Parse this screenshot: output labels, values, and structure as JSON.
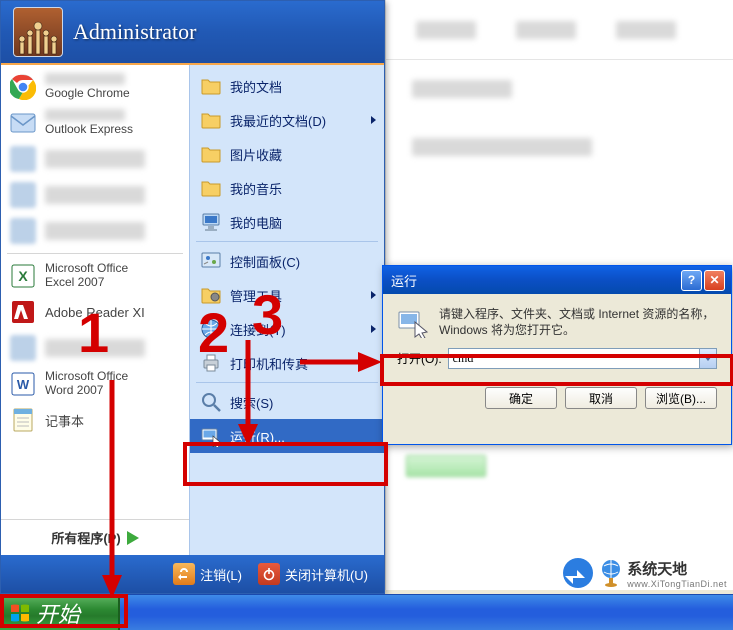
{
  "user_name": "Administrator",
  "left_items": [
    {
      "id": "chrome",
      "line1": "Google Chrome",
      "twoLine": true,
      "blurTop": true
    },
    {
      "id": "outlook",
      "line1": "Outlook Express",
      "twoLine": true,
      "blurTop": true
    },
    {
      "id": "blurred3",
      "line1": "",
      "blurAll": true
    },
    {
      "id": "blurred4",
      "line1": "",
      "blurAll": true
    },
    {
      "id": "blurred5",
      "line1": "",
      "blurAll": true
    },
    {
      "id": "excel",
      "line1": "Microsoft Office",
      "line2": "Excel 2007",
      "twoLine": true
    },
    {
      "id": "adobe",
      "line1": "Adobe Reader XI"
    },
    {
      "id": "blurred8",
      "line1": "",
      "blurAll": true
    },
    {
      "id": "word",
      "line1": "Microsoft Office",
      "line2": "Word 2007",
      "twoLine": true
    },
    {
      "id": "notepad",
      "line1": "记事本"
    }
  ],
  "all_programs_label": "所有程序(P)",
  "right_items": [
    {
      "id": "mydocs",
      "label": "我的文档",
      "icon": "folder"
    },
    {
      "id": "recent",
      "label": "我最近的文档(D)",
      "icon": "folder",
      "hasSub": true
    },
    {
      "id": "pictures",
      "label": "图片收藏",
      "icon": "folder"
    },
    {
      "id": "music",
      "label": "我的音乐",
      "icon": "folder"
    },
    {
      "id": "mycomputer",
      "label": "我的电脑",
      "icon": "computer"
    },
    {
      "sep": true
    },
    {
      "id": "control",
      "label": "控制面板(C)",
      "icon": "control"
    },
    {
      "id": "admintool",
      "label": "管理工具",
      "icon": "admintool",
      "hasSub": true
    },
    {
      "id": "connect",
      "label": "连接到(T)",
      "icon": "connect",
      "hasSub": true
    },
    {
      "id": "printers",
      "label": "打印机和传真",
      "icon": "printer"
    },
    {
      "sep": true
    },
    {
      "id": "search",
      "label": "搜索(S)",
      "icon": "search"
    },
    {
      "id": "run",
      "label": "运行(R)...",
      "icon": "run",
      "selected": true
    }
  ],
  "footer": {
    "logoff": "注销(L)",
    "shutdown": "关闭计算机(U)"
  },
  "taskbar": {
    "start": "开始"
  },
  "run_dialog": {
    "title": "运行",
    "description": "请键入程序、文件夹、文档或 Internet 资源的名称，Windows 将为您打开它。",
    "open_label": "打开(O):",
    "value": "cmd",
    "buttons": {
      "ok": "确定",
      "cancel": "取消",
      "browse": "浏览(B)..."
    }
  },
  "annotations": {
    "n1": "1",
    "n2": "2",
    "n3": "3"
  },
  "watermark": {
    "main": "系统天地",
    "sub": "www.XiTongTianDi.net"
  }
}
